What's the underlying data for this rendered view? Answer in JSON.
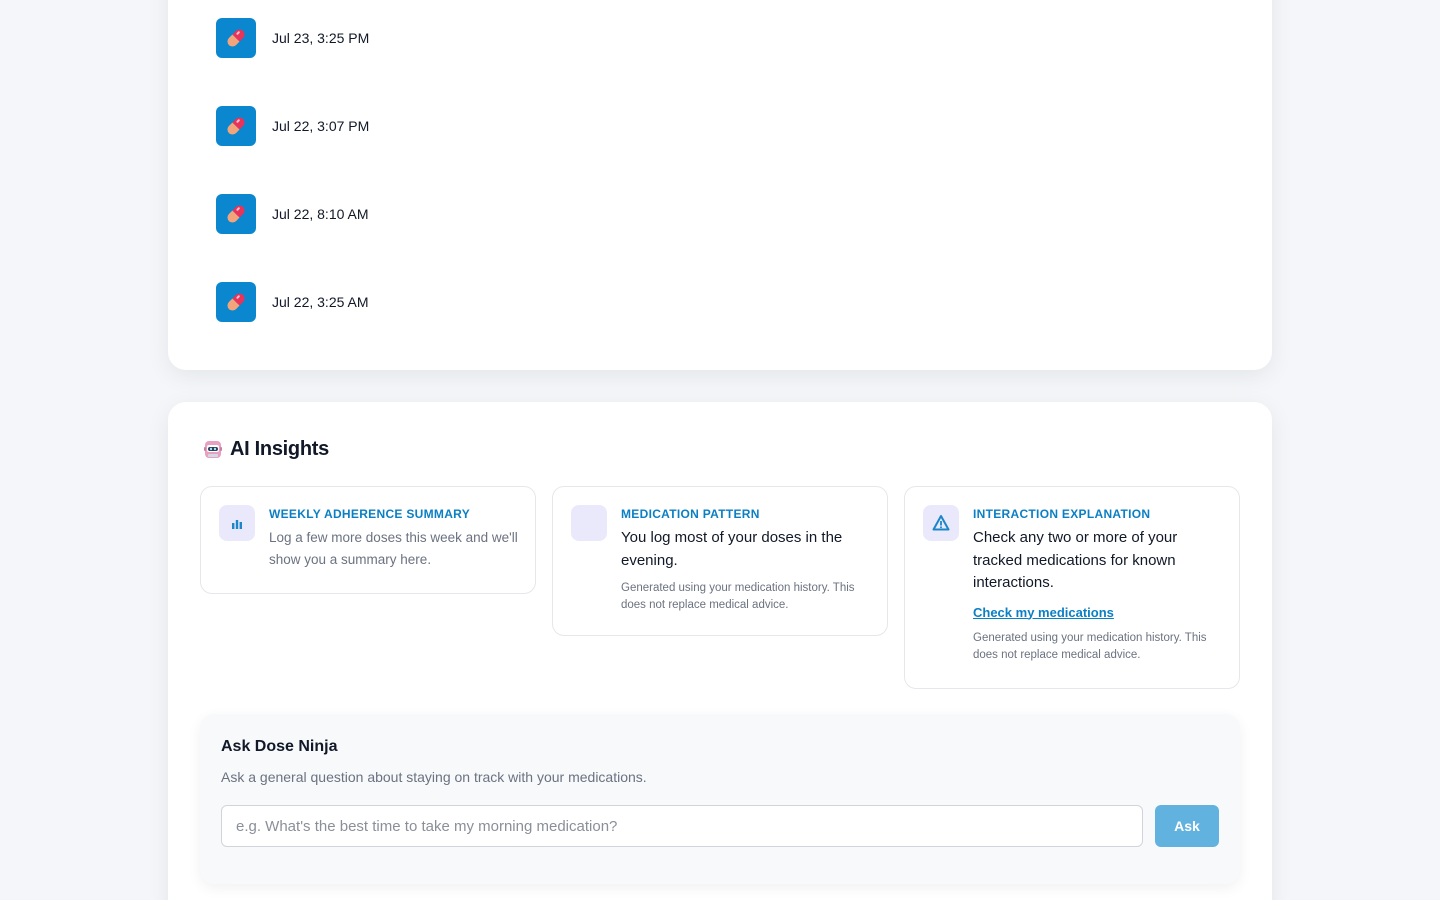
{
  "history": {
    "doses": [
      {
        "time": "Jul 23, 3:25 PM",
        "icon": "pill-icon"
      },
      {
        "time": "Jul 22, 3:07 PM",
        "icon": "pill-icon"
      },
      {
        "time": "Jul 22, 8:10 AM",
        "icon": "pill-icon"
      },
      {
        "time": "Jul 22, 3:25 AM",
        "icon": "pill-icon"
      }
    ]
  },
  "insights": {
    "title": "AI Insights",
    "title_icon": "robot-icon",
    "cards": [
      {
        "label": "WEEKLY ADHERENCE SUMMARY",
        "icon": "bar-chart-icon",
        "text": "Log a few more doses this week and we'll show you a summary here."
      },
      {
        "label": "MEDICATION PATTERN",
        "icon": "pattern-icon",
        "text": "You log most of your doses in the evening.",
        "disclaimer": "Generated using your medication history. This does not replace medical advice."
      },
      {
        "label": "INTERACTION EXPLANATION",
        "icon": "warning-icon",
        "text": "Check any two or more of your tracked medications for known interactions.",
        "link": "Check my medications",
        "disclaimer": "Generated using your medication history. This does not replace medical advice."
      }
    ]
  },
  "ask": {
    "title": "Ask Dose Ninja",
    "subtitle": "Ask a general question about staying on track with your medications.",
    "placeholder": "e.g. What's the best time to take my morning medication?",
    "button": "Ask"
  },
  "colors": {
    "accent": "#0b7fc4",
    "pill_badge": "#0b87d0",
    "ask_button": "#62b2df",
    "icon_tint": "#e9e9fb"
  }
}
